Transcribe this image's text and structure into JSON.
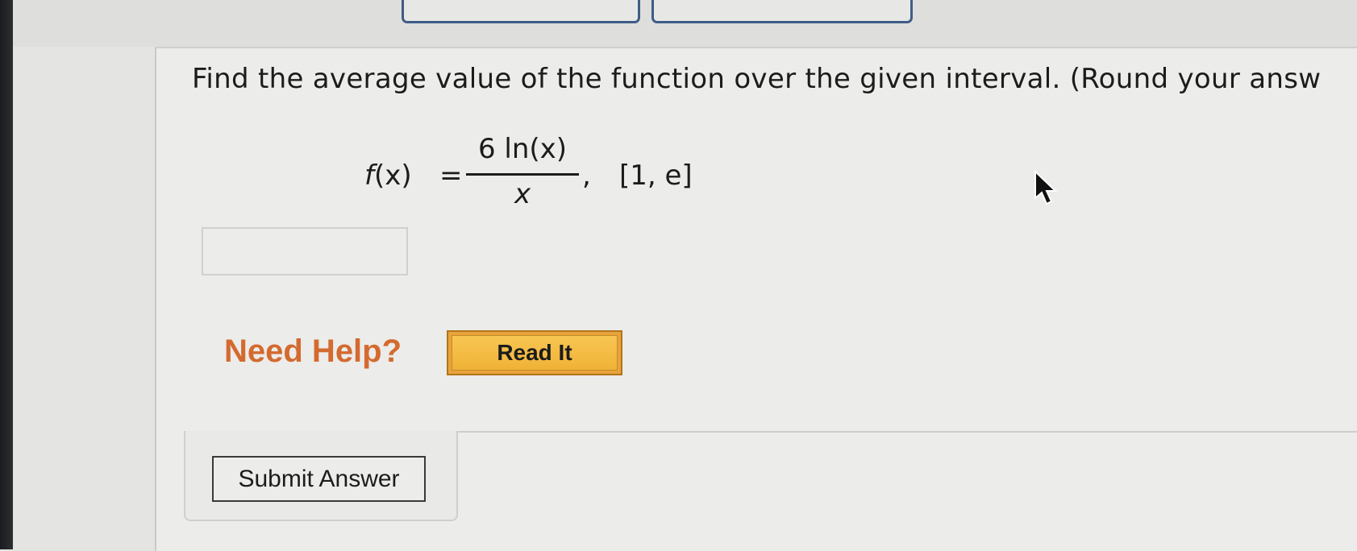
{
  "question": {
    "prompt": "Find the average value of the function over the given interval. (Round your answ",
    "formula": {
      "function_name": "f",
      "variable": "(x)",
      "equals": "=",
      "numerator": "6 ln(x)",
      "denominator": "x",
      "separator": ",",
      "interval": "[1, e]"
    }
  },
  "answer": {
    "value": "",
    "placeholder": ""
  },
  "help": {
    "label": "Need Help?",
    "read_it_label": "Read It"
  },
  "submit": {
    "label": "Submit Answer"
  },
  "icons": {
    "cursor": "mouse-pointer-icon"
  },
  "colors": {
    "help_text": "#d46a2f",
    "read_it_bg": "#f0b237",
    "top_box_border": "#3f5c86"
  }
}
